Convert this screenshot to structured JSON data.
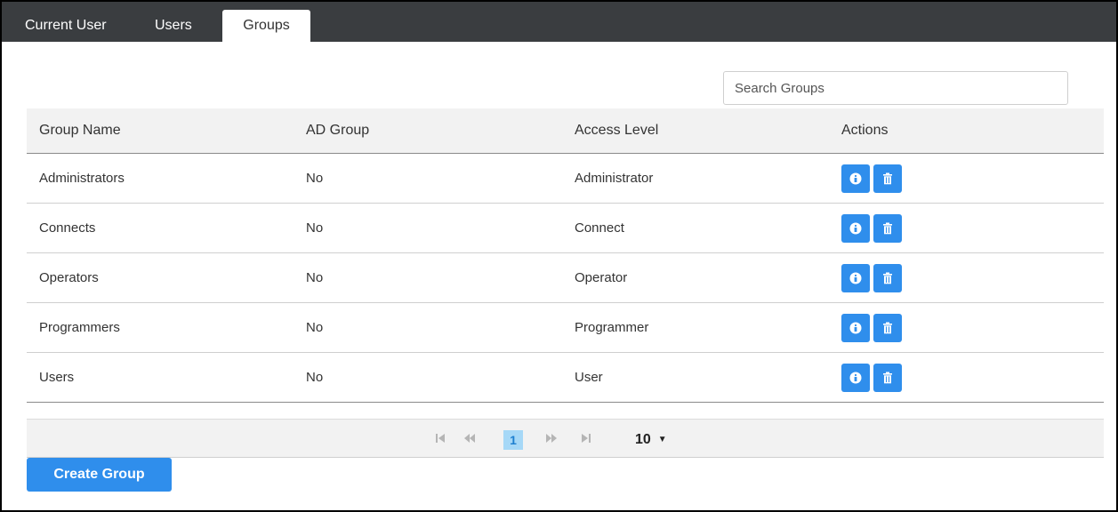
{
  "tabs": {
    "current_user": "Current User",
    "users": "Users",
    "groups": "Groups",
    "active": "Groups"
  },
  "search": {
    "placeholder": "Search Groups",
    "value": ""
  },
  "table": {
    "headers": [
      "Group Name",
      "AD Group",
      "Access Level",
      "Actions"
    ],
    "rows": [
      {
        "name": "Administrators",
        "ad": "No",
        "access": "Administrator"
      },
      {
        "name": "Connects",
        "ad": "No",
        "access": "Connect"
      },
      {
        "name": "Operators",
        "ad": "No",
        "access": "Operator"
      },
      {
        "name": "Programmers",
        "ad": "No",
        "access": "Programmer"
      },
      {
        "name": "Users",
        "ad": "No",
        "access": "User"
      }
    ],
    "row_actions": [
      "info-icon",
      "trash-icon"
    ]
  },
  "pagination": {
    "current_page": "1",
    "page_size": "10",
    "icons": [
      "first-page-icon",
      "prev-page-icon",
      "next-page-icon",
      "last-page-icon"
    ]
  },
  "create_button": "Create Group",
  "colors": {
    "tabbar": "#3a3d40",
    "accent": "#2f8eec",
    "page_highlight": "#a6d8f7",
    "header_bg": "#f2f2f2"
  }
}
